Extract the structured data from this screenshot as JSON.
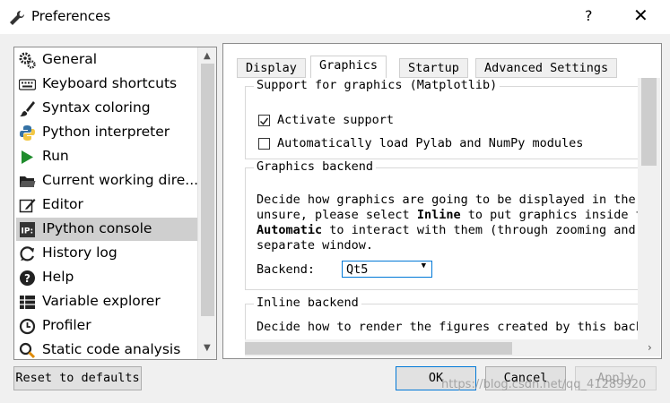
{
  "window": {
    "title": "Preferences",
    "help_label": "?",
    "close_label": "✕"
  },
  "sidebar": {
    "items": [
      {
        "label": "General",
        "icon": "gears-icon"
      },
      {
        "label": "Keyboard shortcuts",
        "icon": "keyboard-icon"
      },
      {
        "label": "Syntax coloring",
        "icon": "paintbrush-icon"
      },
      {
        "label": "Python interpreter",
        "icon": "python-icon"
      },
      {
        "label": "Run",
        "icon": "play-icon"
      },
      {
        "label": "Current working dire...",
        "icon": "folder-icon"
      },
      {
        "label": "Editor",
        "icon": "edit-icon"
      },
      {
        "label": "IPython console",
        "icon": "ipython-icon"
      },
      {
        "label": "History log",
        "icon": "history-icon"
      },
      {
        "label": "Help",
        "icon": "help-icon"
      },
      {
        "label": "Variable explorer",
        "icon": "table-icon"
      },
      {
        "label": "Profiler",
        "icon": "clock-icon"
      },
      {
        "label": "Static code analysis",
        "icon": "magnifier-icon"
      }
    ],
    "selected": "IPython console"
  },
  "tabs": [
    "Display",
    "Graphics",
    "Startup",
    "Advanced Settings"
  ],
  "active_tab": "Graphics",
  "graphics": {
    "support_group_title": "Support for graphics (Matplotlib)",
    "activate_support_label": "Activate support",
    "activate_support_checked": true,
    "auto_pylab_label": "Automatically load Pylab and NumPy modules",
    "auto_pylab_checked": false,
    "backend_group_title": "Graphics backend",
    "backend_desc_line1": "Decide how graphics are going to be displayed in the",
    "backend_desc_line2_a": "unsure, please select ",
    "backend_desc_line2_b": "Inline",
    "backend_desc_line2_c": " to put graphics inside t",
    "backend_desc_line3_a": "Automatic",
    "backend_desc_line3_b": " to interact with them (through zooming and",
    "backend_desc_line4": "separate window.",
    "backend_label": "Backend:",
    "backend_value": "Qt5",
    "inline_group_title": "Inline backend",
    "inline_desc": "Decide how to render the figures created by this back"
  },
  "buttons": {
    "reset": "Reset to defaults",
    "ok": "OK",
    "cancel": "Cancel",
    "apply": "Apply"
  },
  "watermark": "https://blog.csdn.net/qq_41289920"
}
